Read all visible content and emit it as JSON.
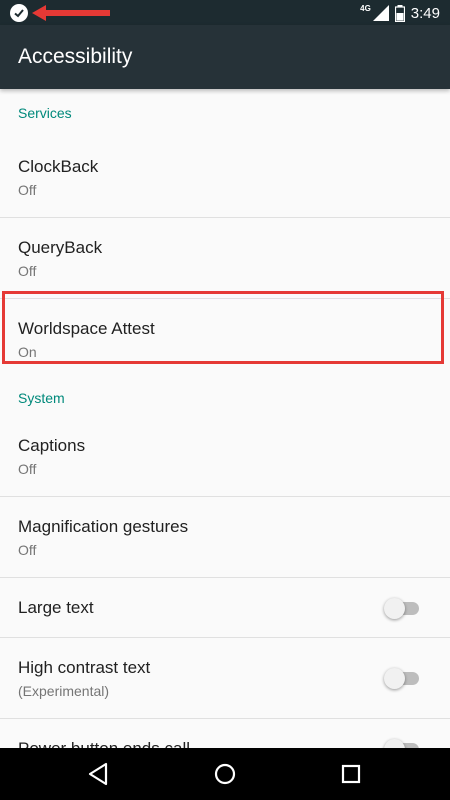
{
  "status_bar": {
    "network": "4G",
    "time": "3:49"
  },
  "app_bar": {
    "title": "Accessibility"
  },
  "sections": {
    "services": {
      "header": "Services",
      "items": [
        {
          "title": "ClockBack",
          "summary": "Off"
        },
        {
          "title": "QueryBack",
          "summary": "Off"
        },
        {
          "title": "Worldspace Attest",
          "summary": "On"
        }
      ]
    },
    "system": {
      "header": "System",
      "items": [
        {
          "title": "Captions",
          "summary": "Off"
        },
        {
          "title": "Magnification gestures",
          "summary": "Off"
        },
        {
          "title": "Large text",
          "toggle": false
        },
        {
          "title": "High contrast text",
          "summary": "(Experimental)",
          "toggle": false
        },
        {
          "title": "Power button ends call",
          "toggle": false
        }
      ]
    }
  },
  "colors": {
    "status_bar": "#1d2b30",
    "app_bar": "#263238",
    "section_header": "#00897b",
    "highlight": "#e53935"
  },
  "icons": [
    "check-circle-icon",
    "red-arrow-icon",
    "signal-icon",
    "battery-icon",
    "back-icon",
    "home-icon",
    "recents-icon"
  ]
}
